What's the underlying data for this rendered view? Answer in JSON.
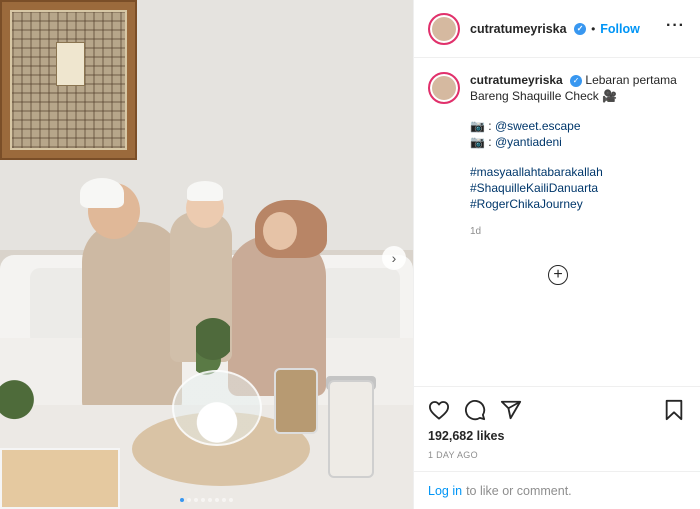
{
  "post": {
    "username": "cutratumeyriska",
    "verified_glyph": "✓",
    "header_separator": "•",
    "follow_label": "Follow",
    "more_glyph": "···",
    "caption": {
      "username": "cutratumeyriska",
      "line1": "Lebaran pertama",
      "line2": "Bareng Shaquille Check 🎥",
      "credit1_prefix": "📷 :",
      "credit1_tag": "@sweet.escape",
      "credit2_prefix": "📷 :",
      "credit2_tag": "@yantiadeni",
      "hashtags": [
        "#masyaallahtabarakallah",
        "#ShaquilleKailiDanuarta",
        "#RogerChikaJourney"
      ],
      "time": "1d"
    },
    "load_more_glyph": "+",
    "likes": "192,682 likes",
    "posted_ago": "1 DAY AGO",
    "login_link": "Log in",
    "login_text": "to like or comment."
  },
  "carousel": {
    "next_glyph": "›",
    "slide_count": 8,
    "active_index": 0
  },
  "icons": [
    "heart-icon",
    "comment-icon",
    "share-icon",
    "bookmark-icon",
    "more-options-icon",
    "chevron-right-icon"
  ],
  "colors": {
    "accent": "#0095f6",
    "hashtag": "#00376b",
    "muted": "#8e8e8e",
    "story_ring": "#e1306c"
  }
}
